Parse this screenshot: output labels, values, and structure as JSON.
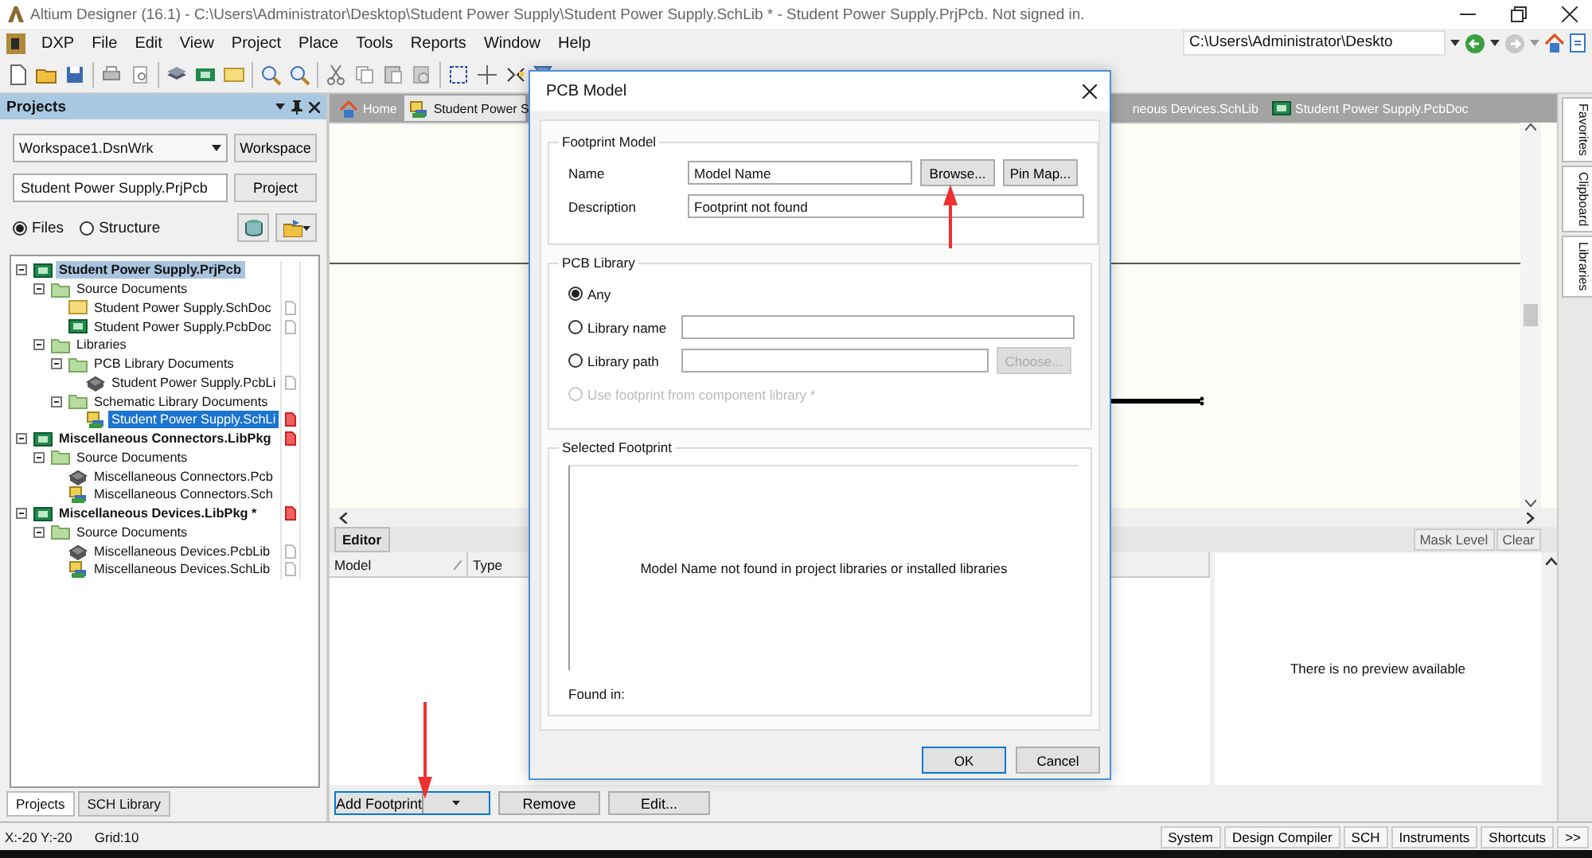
{
  "window": {
    "title": "Altium Designer (16.1) - C:\\Users\\Administrator\\Desktop\\Student Power Supply\\Student Power Supply.SchLib * - Student Power Supply.PrjPcb. Not signed in."
  },
  "menu": [
    "DXP",
    "File",
    "Edit",
    "View",
    "Project",
    "Place",
    "Tools",
    "Reports",
    "Window",
    "Help"
  ],
  "path_field": {
    "value": "C:\\Users\\Administrator\\Deskto"
  },
  "projects_panel": {
    "title": "Projects",
    "workspace": {
      "value": "Workspace1.DsnWrk",
      "button": "Workspace"
    },
    "project": {
      "value": "Student Power Supply.PrjPcb",
      "button": "Project"
    },
    "view_options": [
      {
        "label": "Files",
        "selected": true
      },
      {
        "label": "Structure",
        "selected": false
      }
    ],
    "tree": [
      {
        "label": "Student Power Supply.PrjPcb",
        "kind": "project",
        "current": true,
        "selected": false,
        "expanded": true,
        "children": [
          {
            "label": "Source Documents",
            "kind": "folder",
            "selected": false,
            "expanded": true,
            "children": [
              {
                "label": "Student Power Supply.SchDoc",
                "kind": "schdoc",
                "selected": false,
                "modified": false
              },
              {
                "label": "Student Power Supply.PcbDoc",
                "kind": "pcbdoc",
                "selected": false,
                "modified": false
              }
            ]
          },
          {
            "label": "Libraries",
            "kind": "folder",
            "selected": false,
            "expanded": true,
            "children": [
              {
                "label": "PCB Library Documents",
                "kind": "folder",
                "selected": false,
                "expanded": true,
                "children": [
                  {
                    "label": "Student Power Supply.PcbLi",
                    "kind": "pcblib",
                    "selected": false,
                    "modified": false
                  }
                ]
              },
              {
                "label": "Schematic Library Documents",
                "kind": "folder",
                "selected": false,
                "expanded": true,
                "children": [
                  {
                    "label": "Student Power Supply.SchLi",
                    "kind": "schlib",
                    "selected": true,
                    "modified": true
                  }
                ]
              }
            ]
          }
        ]
      },
      {
        "label": "Miscellaneous Connectors.LibPkg",
        "kind": "project",
        "current": false,
        "selected": false,
        "expanded": true,
        "modified": true,
        "children": [
          {
            "label": "Source Documents",
            "kind": "folder",
            "selected": false,
            "expanded": true,
            "children": [
              {
                "label": "Miscellaneous Connectors.Pcb",
                "kind": "pcblib",
                "selected": false
              },
              {
                "label": "Miscellaneous Connectors.Sch",
                "kind": "schlib",
                "selected": false
              }
            ]
          }
        ]
      },
      {
        "label": "Miscellaneous Devices.LibPkg *",
        "kind": "project",
        "current": false,
        "selected": false,
        "expanded": true,
        "modified": true,
        "children": [
          {
            "label": "Source Documents",
            "kind": "folder",
            "selected": false,
            "expanded": true,
            "children": [
              {
                "label": "Miscellaneous Devices.PcbLib",
                "kind": "pcblib",
                "selected": false,
                "modified": false
              },
              {
                "label": "Miscellaneous Devices.SchLib",
                "kind": "schlib",
                "selected": false,
                "modified": false
              }
            ]
          }
        ]
      }
    ],
    "tabs": [
      {
        "label": "Projects",
        "selected": true
      },
      {
        "label": "SCH Library",
        "selected": false
      }
    ]
  },
  "document_tabs": [
    {
      "label": "Home",
      "kind": "home",
      "selected": false
    },
    {
      "label": "Student Power S",
      "kind": "schlib",
      "selected": true
    },
    {
      "label": "neous Devices.SchLib",
      "kind": "text",
      "selected": false
    },
    {
      "label": "Student Power Supply.PcbDoc",
      "kind": "pcbdoc",
      "selected": false
    }
  ],
  "side_tabs": [
    "Favorites",
    "Clipboard",
    "Libraries"
  ],
  "editor": {
    "tab": "Editor",
    "buttons": [
      "Mask Level",
      "Clear"
    ],
    "columns": [
      "Model",
      "Type"
    ],
    "preview_message": "There is no preview available",
    "actions": [
      {
        "label": "Add Footprint",
        "kind": "split"
      },
      {
        "label": "Remove",
        "kind": "plain"
      },
      {
        "label": "Edit...",
        "kind": "plain"
      }
    ]
  },
  "status_bar": {
    "coordinates": "X:-20 Y:-20",
    "grid": "Grid:10",
    "buttons": [
      "System",
      "Design Compiler",
      "SCH",
      "Instruments",
      "Shortcuts",
      ">>"
    ]
  },
  "dialog": {
    "title": "PCB Model",
    "footprint_model": {
      "title": "Footprint Model",
      "name_label": "Name",
      "name_value": "Model Name",
      "browse": "Browse...",
      "pin_map": "Pin Map...",
      "description_label": "Description",
      "description_value": "Footprint not found"
    },
    "pcb_library": {
      "title": "PCB Library",
      "options": [
        {
          "label": "Any",
          "kind": "plain",
          "selected": true,
          "disabled": false
        },
        {
          "label": "Library name",
          "kind": "field",
          "selected": false,
          "disabled": false
        },
        {
          "label": "Library path",
          "kind": "field_button",
          "selected": false,
          "disabled": false
        },
        {
          "label": "Use footprint from component library *",
          "kind": "plain",
          "selected": false,
          "disabled": true
        }
      ],
      "choose_button": {
        "label": "Choose...",
        "disabled": true
      }
    },
    "selected_footprint": {
      "title": "Selected Footprint",
      "message": "Model Name not found in project libraries or installed libraries",
      "found_in": "Found in:"
    },
    "buttons": [
      {
        "label": "OK",
        "default": true
      },
      {
        "label": "Cancel",
        "default": false
      }
    ]
  }
}
